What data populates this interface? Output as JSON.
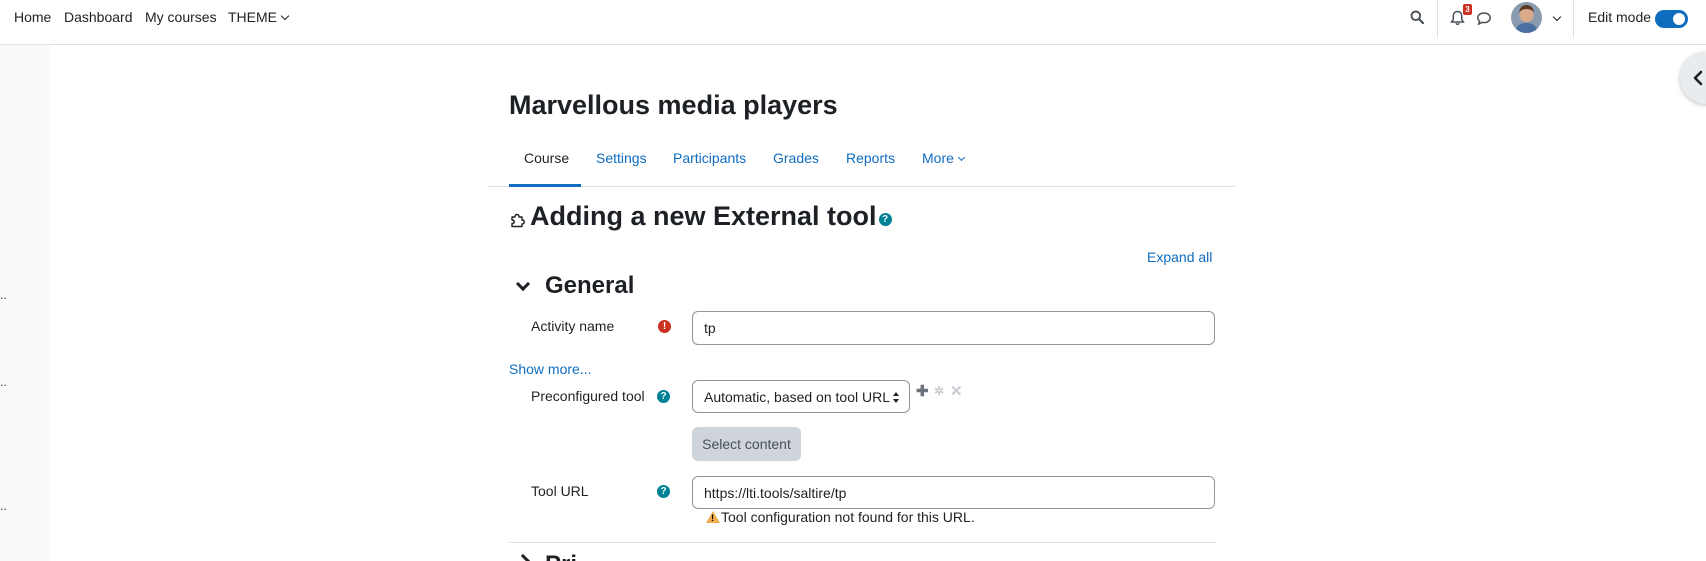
{
  "navbar": {
    "links": [
      "Home",
      "Dashboard",
      "My courses",
      "THEME"
    ],
    "notification_count": "3",
    "edit_mode_label": "Edit mode",
    "edit_mode_on": true
  },
  "course": {
    "title": "Marvellous media players",
    "tabs": [
      "Course",
      "Settings",
      "Participants",
      "Grades",
      "Reports",
      "More"
    ],
    "active_tab": "Course"
  },
  "form": {
    "heading": "Adding a new External tool",
    "expand_all": "Expand all",
    "general_section": "General",
    "activity_name_label": "Activity name",
    "activity_name_value": "tp",
    "show_more": "Show more...",
    "preconfigured_label": "Preconfigured tool",
    "preconfigured_value": "Automatic, based on tool URL",
    "select_content": "Select content",
    "tool_url_label": "Tool URL",
    "tool_url_value": "https://lti.tools/saltire/tp",
    "tool_url_warning": "Tool configuration not found for this URL.",
    "next_section_partial": "Pri"
  },
  "left_drawer_dots": [
    "..",
    "..",
    ".."
  ],
  "colors": {
    "link": "#0f6cbf",
    "help": "#008196",
    "required": "#ca3120",
    "warning": "#f0ad4e"
  }
}
